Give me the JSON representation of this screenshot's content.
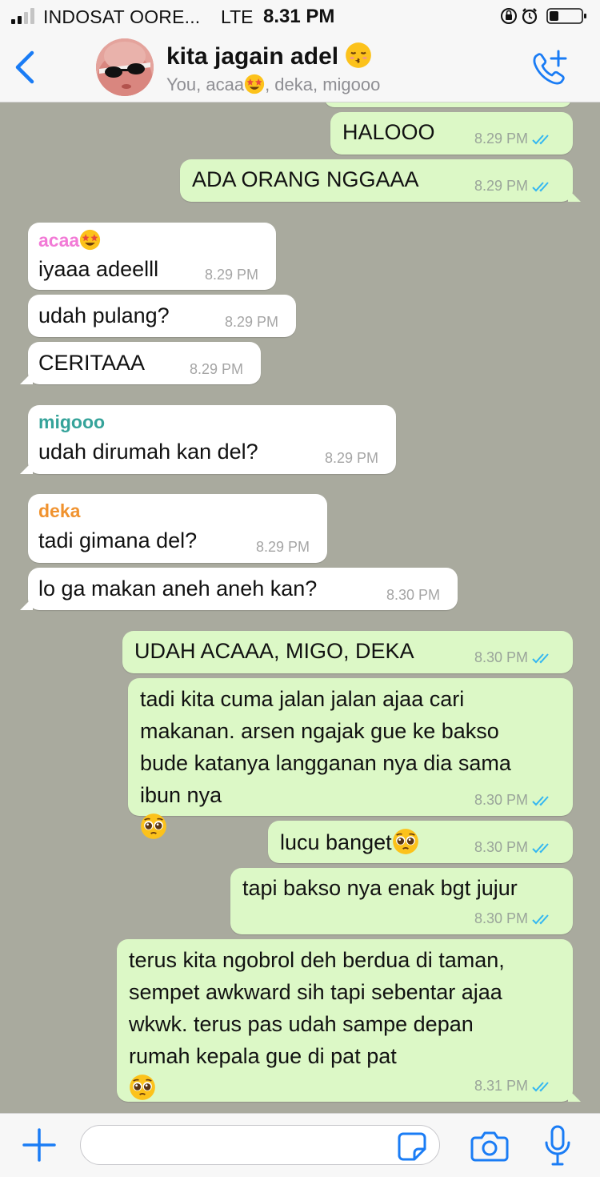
{
  "status_bar": {
    "carrier": "INDOSAT OORE...",
    "network": "LTE",
    "time": "8.31 PM"
  },
  "header": {
    "back_icon": "chevron-left-icon",
    "title": "kita jagain adel",
    "subtitle_pre": "You, acaa",
    "subtitle_post": ", deka, migooo",
    "add_call_icon": "phone-plus-icon",
    "accent_color": "#1a7cf5"
  },
  "messages": [
    {
      "text": "HALOOO",
      "time": "8.29 PM"
    },
    {
      "text": "ADA ORANG NGGAAA",
      "time": "8.29 PM"
    },
    {
      "sender": "acaa",
      "text": "iyaaa adeelll",
      "time": "8.29 PM"
    },
    {
      "text": "udah pulang?",
      "time": "8.29 PM"
    },
    {
      "text": "CERITAAA",
      "time": "8.29 PM"
    },
    {
      "sender": "migooo",
      "text": "udah dirumah kan del?",
      "time": "8.29 PM"
    },
    {
      "sender": "deka",
      "text": "tadi gimana del?",
      "time": "8.29 PM"
    },
    {
      "text": "lo ga makan aneh aneh kan?",
      "time": "8.30 PM"
    },
    {
      "text": "UDAH ACAAA, MIGO, DEKA",
      "time": "8.30 PM"
    },
    {
      "lines": [
        "tadi kita cuma jalan jalan ajaa cari",
        "makanan. arsen ngajak gue ke bakso",
        "bude katanya langganan nya dia sama",
        "ibun nya"
      ],
      "time": "8.30 PM"
    },
    {
      "text": "lucu banget",
      "time": "8.30 PM"
    },
    {
      "text": "tapi bakso nya enak bgt jujur",
      "time": "8.30 PM"
    },
    {
      "lines": [
        "terus kita ngobrol deh berdua di taman,",
        "sempet awkward sih tapi sebentar ajaa",
        "wkwk. terus pas udah sampe depan",
        "rumah kepala gue di pat pat"
      ],
      "time": "8.31 PM"
    }
  ],
  "sender_colors": {
    "acaa": "#f27ad6",
    "migooo": "#35a39a",
    "deka": "#f0922e"
  },
  "composer": {
    "placeholder": "",
    "plus_icon": "plus-icon",
    "sticker_icon": "sticker-icon",
    "camera_icon": "camera-icon",
    "mic_icon": "microphone-icon"
  }
}
